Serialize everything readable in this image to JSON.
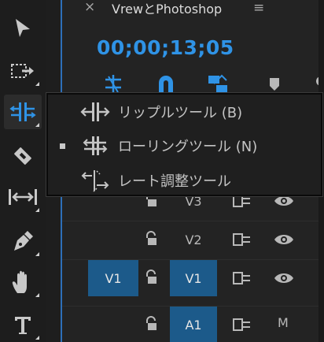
{
  "panel": {
    "close_label": "×",
    "sequence_title": "VrewとPhotoshop",
    "menu_icon": "≡",
    "timecode": "00;00;13;05"
  },
  "tools": [
    {
      "name": "selection-tool",
      "icon": "arrow-icon"
    },
    {
      "name": "track-select-tool",
      "icon": "track-select-forward-icon"
    },
    {
      "name": "ripple-edit-tool",
      "icon": "ripple-edit-icon",
      "active": true
    },
    {
      "name": "razor-tool",
      "icon": "razor-icon"
    },
    {
      "name": "slip-tool",
      "icon": "slip-icon"
    },
    {
      "name": "pen-tool",
      "icon": "pen-icon"
    },
    {
      "name": "hand-tool",
      "icon": "hand-icon"
    },
    {
      "name": "type-tool",
      "icon": "type-icon"
    }
  ],
  "flyout": {
    "items": [
      {
        "label": "リップルツール (B)",
        "icon": "ripple-edit-icon",
        "selected": false
      },
      {
        "label": "ローリングツール (N)",
        "icon": "rolling-edit-icon",
        "selected": true
      },
      {
        "label": "レート調整ツール",
        "icon": "rate-stretch-icon",
        "selected": false
      }
    ]
  },
  "tracks": [
    {
      "name": "V3",
      "source": "",
      "type": "video"
    },
    {
      "name": "V2",
      "source": "",
      "type": "video"
    },
    {
      "name": "V1",
      "source": "V1",
      "type": "video"
    },
    {
      "name": "A1",
      "source": "",
      "type": "audio",
      "mute_label": "M"
    }
  ],
  "colors": {
    "accent": "#2f93e6",
    "track_target": "#1c5a8a",
    "background": "#232323"
  }
}
